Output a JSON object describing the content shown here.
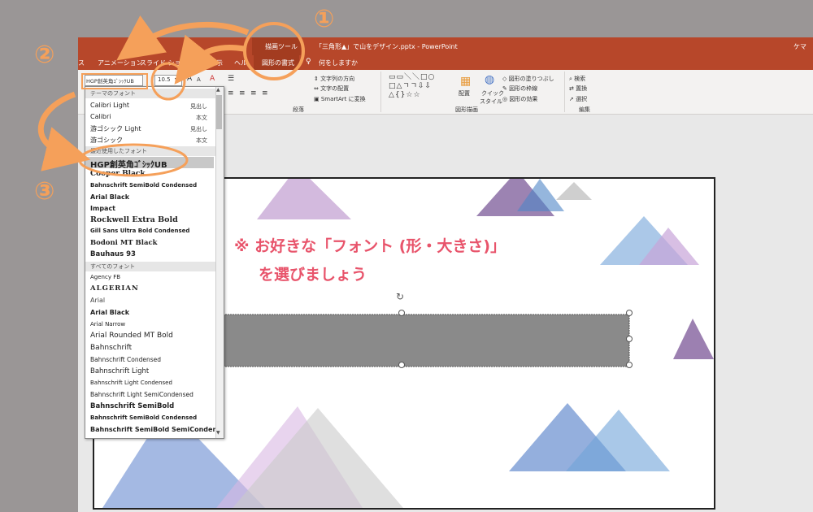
{
  "window": {
    "context_tab": "描画ツール",
    "title": "「三角形▲」で山をデザイン.pptx - PowerPoint",
    "user_initial": "ケマ"
  },
  "tabs": {
    "t1": "ス",
    "t2": "アニメーション",
    "t3": "スライド ショー",
    "t4": "表示",
    "t5": "ヘル",
    "format": "図形の書式",
    "search": "何をしますか"
  },
  "ribbon": {
    "font_name": "HGP創英角ｺﾞｼｯｸUB",
    "font_size": "10.5",
    "grow_font": "A",
    "shrink_font": "A",
    "text_direction": "文字列の方向",
    "align_text": "文字の配置",
    "smartart": "SmartArt に変換",
    "paragraph_group": "段落",
    "arrange": "配置",
    "quick_style_1": "クイック",
    "quick_style_2": "スタイル",
    "shape_fill": "図形の塗りつぶし",
    "shape_outline": "図形の枠線",
    "shape_effects": "図形の効果",
    "drawing_group": "図形描画",
    "find": "検索",
    "replace": "置換",
    "select": "選択",
    "edit_group": "編集"
  },
  "font_dropdown": {
    "theme_header": "テーマのフォント",
    "theme_fonts": [
      {
        "name": "Calibri Light",
        "role": "見出し"
      },
      {
        "name": "Calibri",
        "role": "本文"
      },
      {
        "name": "游ゴシック Light",
        "role": "見出し"
      },
      {
        "name": "游ゴシック",
        "role": "本文"
      }
    ],
    "recent_header": "最近使用したフォント",
    "recent_fonts": [
      "HGP創英角ｺﾞｼｯｸUB",
      "Cooper Black",
      "Bahnschrift SemiBold Condensed",
      "Arial Black",
      "Impact",
      "Rockwell Extra Bold",
      "Gill Sans Ultra Bold Condensed",
      "Bodoni MT Black",
      "Bauhaus 93"
    ],
    "all_header": "すべてのフォント",
    "all_fonts": [
      "Agency FB",
      "ALGERIAN",
      "Arial",
      "Arial Black",
      "Arial Narrow",
      "Arial Rounded MT Bold",
      "Bahnschrift",
      "Bahnschrift Condensed",
      "Bahnschrift Light",
      "Bahnschrift Light Condensed",
      "Bahnschrift Light SemiCondensed",
      "Bahnschrift SemiBold",
      "Bahnschrift SemiBold Condensed",
      "Bahnschrift SemiBold SemiConden"
    ]
  },
  "annotations": {
    "n1": "①",
    "n2": "②",
    "n3": "③",
    "note_line1": "※ お好きな「フォント (形・大きさ)」",
    "note_line2": "を選びましょう",
    "accent_color": "#f5a05a",
    "note_color": "#e8546b"
  }
}
